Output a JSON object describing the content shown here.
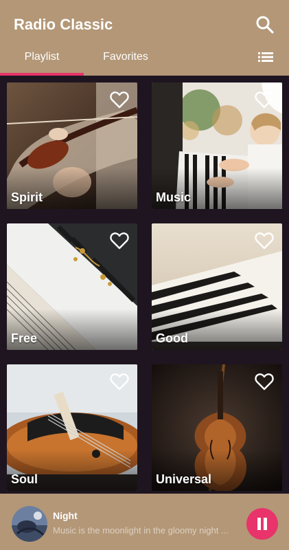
{
  "app": {
    "title": "Radio Classic",
    "accent_color": "#e8336b",
    "bar_color": "#b39777",
    "background_color": "#1e1520"
  },
  "header": {
    "search_icon": "search-icon",
    "menu_icon": "list-menu-icon"
  },
  "tabs": [
    {
      "label": "Playlist",
      "active": true
    },
    {
      "label": "Favorites",
      "active": false
    }
  ],
  "playlists": [
    {
      "name": "Spirit",
      "image": "violin-player",
      "favorite": false
    },
    {
      "name": "Music",
      "image": "child-piano-christmas",
      "favorite": false
    },
    {
      "name": "Free",
      "image": "piano-sheet-music",
      "favorite": false
    },
    {
      "name": "Good",
      "image": "piano-keys",
      "favorite": false
    },
    {
      "name": "Soul",
      "image": "violin-closeup",
      "favorite": false
    },
    {
      "name": "Universal",
      "image": "cello-dark",
      "favorite": false
    }
  ],
  "player": {
    "track": "Night",
    "subtitle": "Music is the moonlight in the gloomy night ...",
    "state": "playing",
    "button_icon": "pause-icon"
  }
}
